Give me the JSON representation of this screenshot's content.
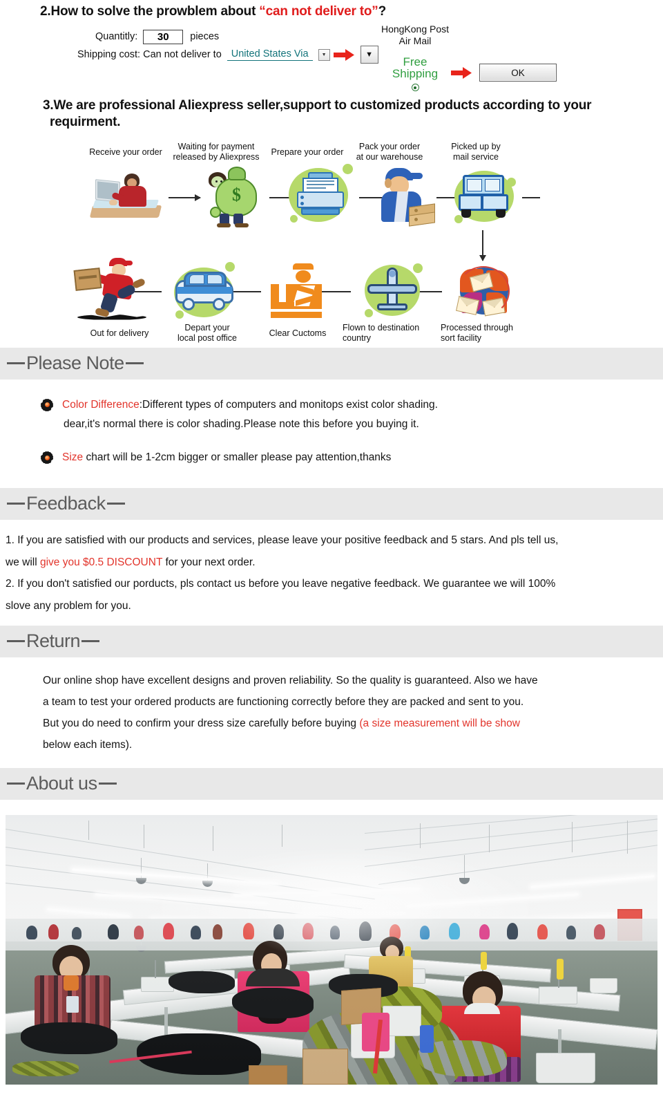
{
  "section2": {
    "heading_prefix": "2.How to solve the prowblem about ",
    "heading_quoted": "“can not deliver to”",
    "heading_suffix": "?",
    "quantity_label": "Quantitly:",
    "quantity_value": "30",
    "pieces_label": "pieces",
    "shipping_label": "Shipping cost: Can not deliver to",
    "destination_value": "United States Via",
    "mini_select_glyph": "▼",
    "big_select_glyph": "▼",
    "post_name_line1": "HongKong Post",
    "post_name_line2": "Air Mail",
    "free_shipping_line1": "Free",
    "free_shipping_line2": "Shipping",
    "ok_label": "OK"
  },
  "section3": {
    "heading_line1": "3.We are professional Aliexpress seller,support to customized products according to your",
    "heading_line2": "requirment.",
    "flow_steps_top": [
      "Receive your order",
      "Waiting for payment\nreleased by Aliexpress",
      "Prepare your order",
      "Pack your order\nat our warehouse",
      "Picked up by\nmail service"
    ],
    "flow_steps_bottom": [
      "Out for delivery",
      "Depart your\nlocal post office",
      "Clear Cuctoms",
      "Flown to destination\ncountry",
      "Processed through\nsort facility"
    ]
  },
  "please_note": {
    "bar_title": "Please Note",
    "item1_red": "Color Difference",
    "item1_rest": ":Different types of computers and monitops exist color shading.",
    "item1_line2": "dear,it's normal there is color shading.Please note this before you buying it.",
    "item2_red": "Size",
    "item2_rest": " chart will be 1-2cm bigger or smaller please pay attention,thanks"
  },
  "feedback": {
    "bar_title": "Feedback",
    "line1a": "1. If you are satisfied with our products and services, please leave your positive feedback and 5 stars. And pls tell us,",
    "line2a": "we will ",
    "line2_red": "give you $0.5  DISCOUNT",
    "line2b": " for your next order.",
    "line3": "2. If you don't satisfied our porducts, pls contact us before you leave negative feedback. We guarantee we will 100%",
    "line4": "slove any problem for you."
  },
  "returns": {
    "bar_title": "Return",
    "line1": "Our online shop have excellent designs and proven reliability. So the quality is guaranteed. Also we have",
    "line2": "a team to test your ordered products are functioning correctly before they are packed and sent to you.",
    "line3a": "But you do need to confirm your dress size carefully before buying ",
    "line3_red": "(a size measurement will be show",
    "line4_red": "below each items)."
  },
  "about_us": {
    "bar_title": "About us",
    "photo_alt": "garment factory sewing floor with workers at long benches"
  },
  "colors": {
    "bar_bg": "#e8e8e8",
    "bar_text": "#5c5c5c",
    "accent_red": "#e2342b",
    "link_teal": "#12737a",
    "free_green": "#2f9e3f",
    "blob_green": "#b6d96a"
  }
}
